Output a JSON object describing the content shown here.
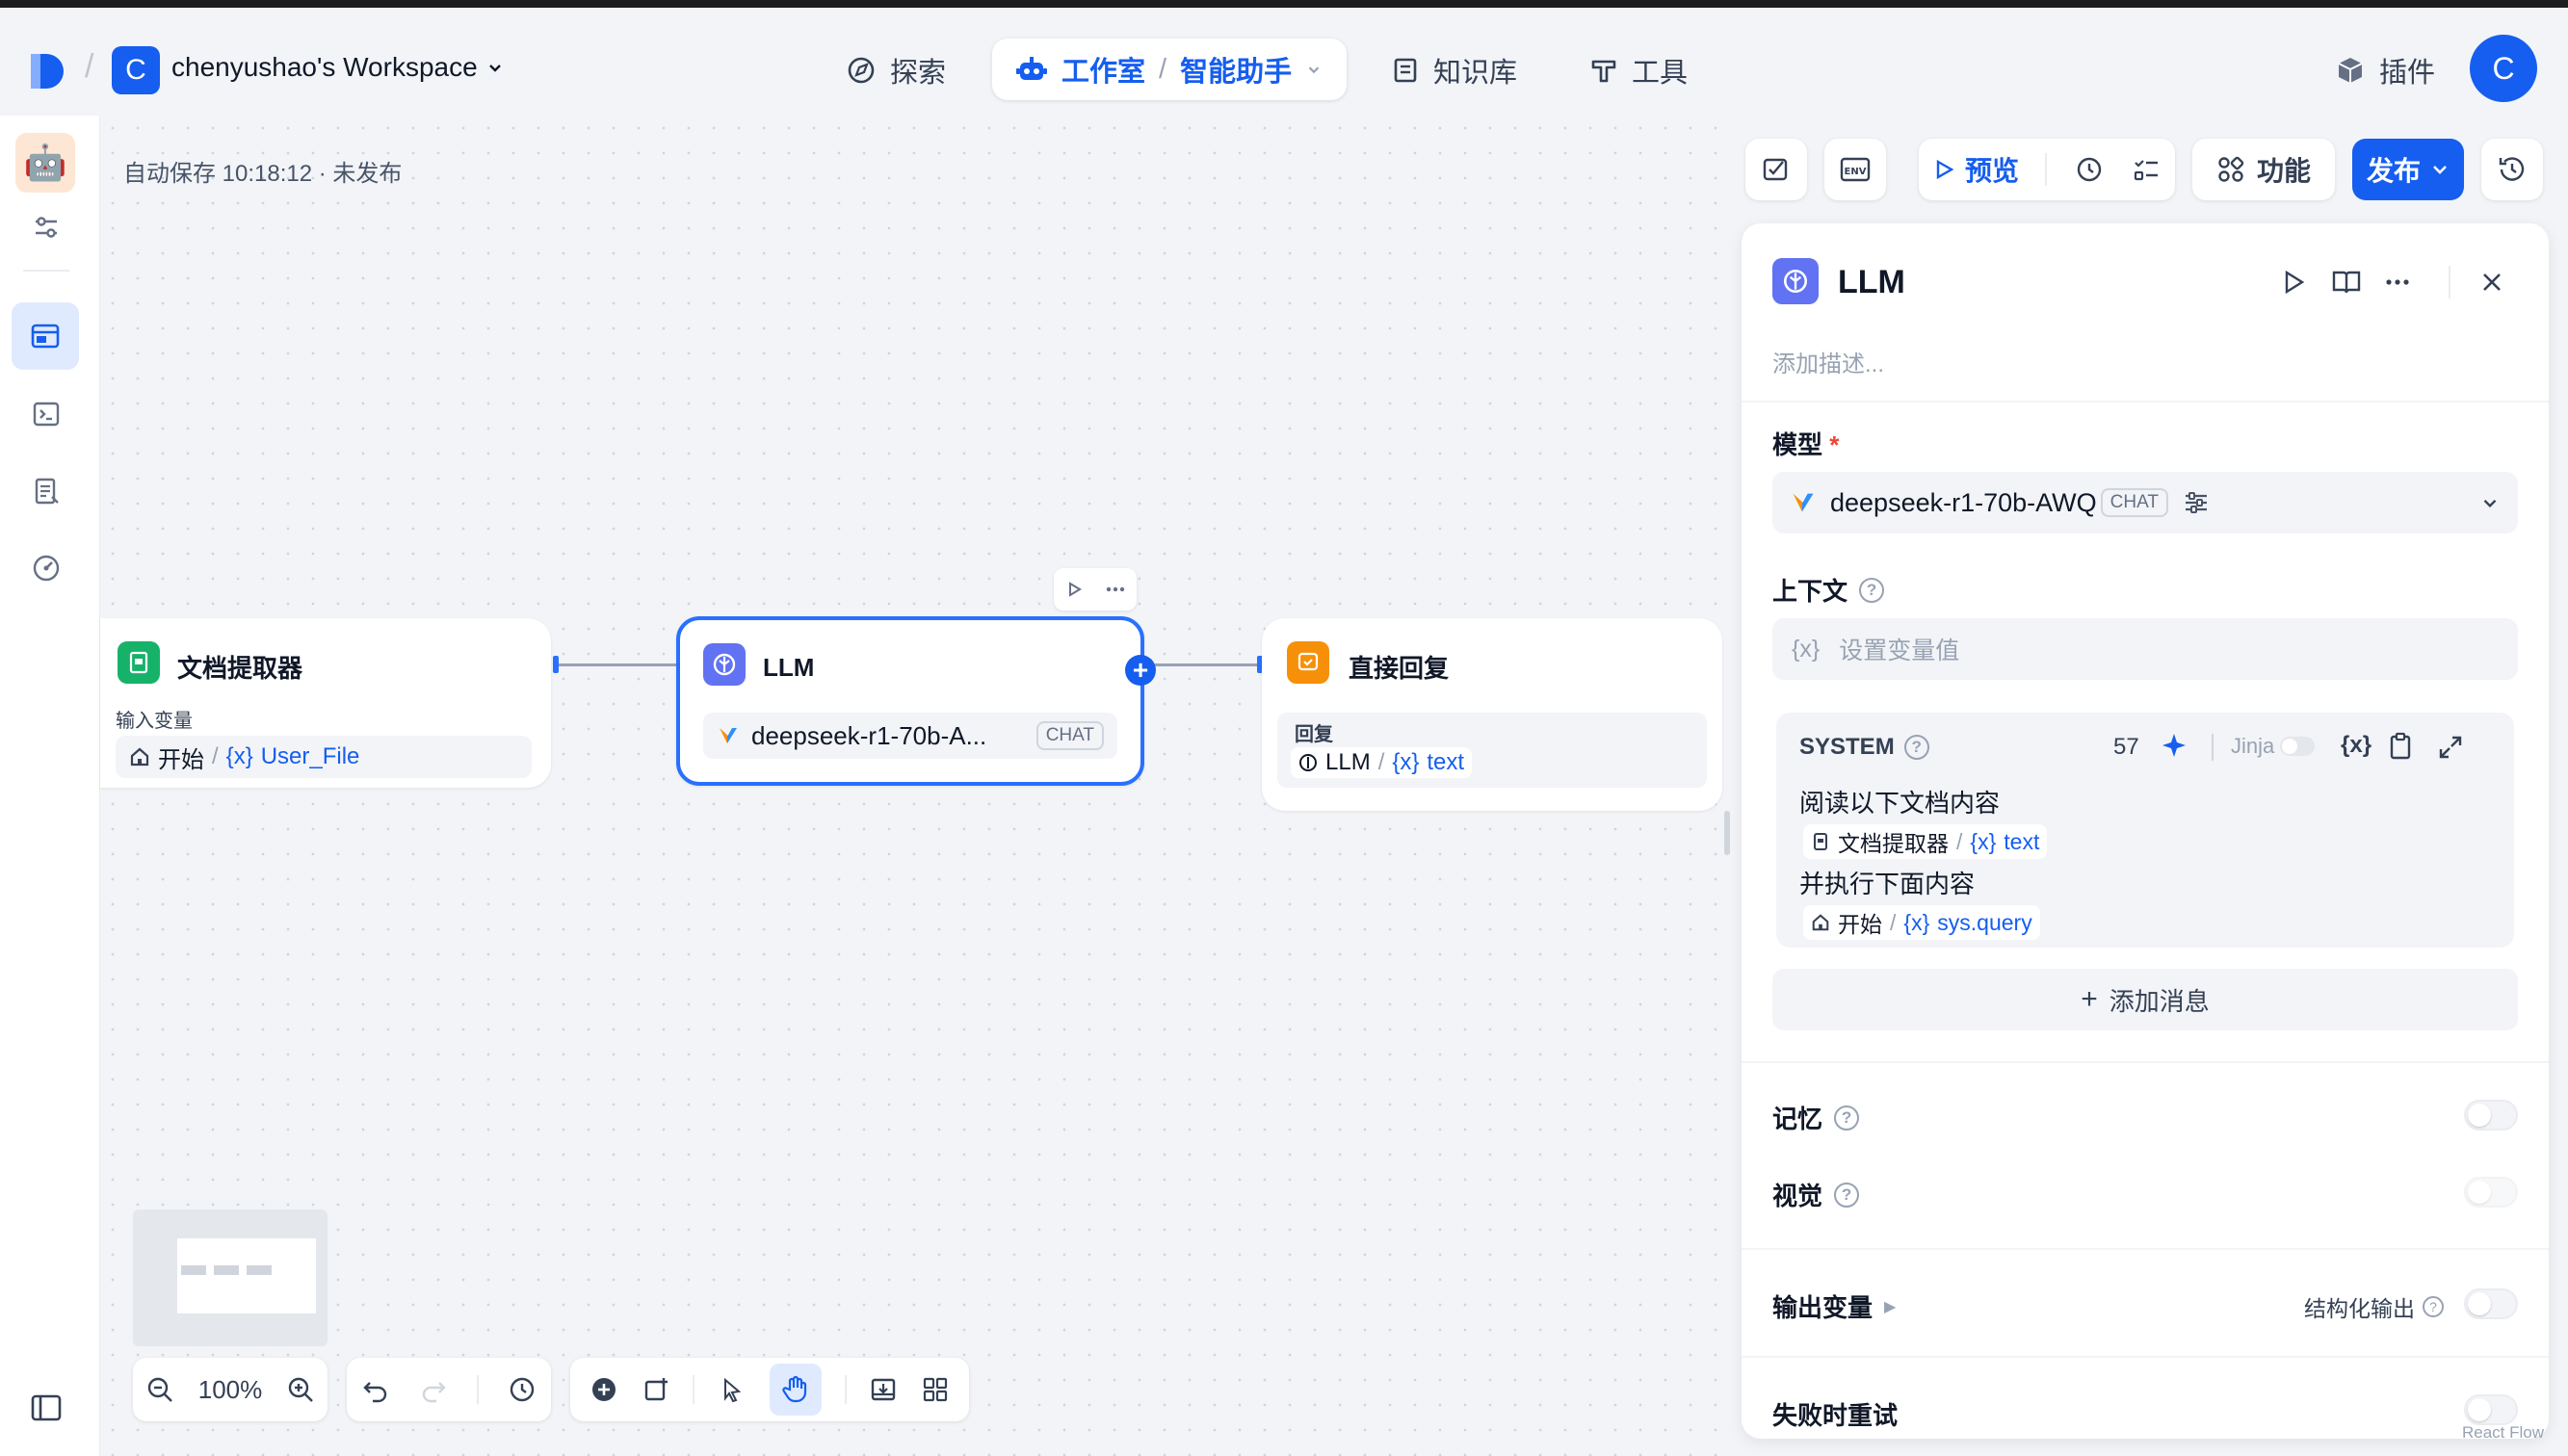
{
  "header": {
    "workspace_initial": "C",
    "workspace_name": "chenyushao's Workspace",
    "nav_explore": "探索",
    "nav_studio": "工作室",
    "nav_app": "智能助手",
    "nav_knowledge": "知识库",
    "nav_tools": "工具",
    "plugins": "插件",
    "avatar_initial": "C"
  },
  "canvas": {
    "autosave": "自动保存 10:18:12 · 未发布",
    "zoom": "100%",
    "nodes": {
      "extractor": {
        "title": "文档提取器",
        "input_label": "输入变量",
        "source": "开始",
        "var": "User_File"
      },
      "llm": {
        "title": "LLM",
        "model": "deepseek-r1-70b-A...",
        "badge": "CHAT"
      },
      "reply": {
        "title": "直接回复",
        "label": "回复",
        "source": "LLM",
        "var": "text"
      }
    },
    "watermark": "React Flow"
  },
  "actions": {
    "preview": "预览",
    "features": "功能",
    "publish": "发布"
  },
  "panel": {
    "title": "LLM",
    "description_placeholder": "添加描述...",
    "model_label": "模型",
    "required_mark": "*",
    "model_name": "deepseek-r1-70b-AWQ",
    "model_badge": "CHAT",
    "context_label": "上下文",
    "context_placeholder": "设置变量值",
    "system_label": "SYSTEM",
    "system_count": "57",
    "jinja_label": "Jinja",
    "prompt_line1": "阅读以下文档内容",
    "prompt_var1_source": "文档提取器",
    "prompt_var1": "text",
    "prompt_line2": "并执行下面内容",
    "prompt_var2_source": "开始",
    "prompt_var2": "sys.query",
    "add_message": "添加消息",
    "memory_label": "记忆",
    "vision_label": "视觉",
    "output_label": "输出变量",
    "structured_label": "结构化输出",
    "retry_label": "失败时重试"
  },
  "colors": {
    "accent": "#155eef",
    "extractor_icon": "#17b26a",
    "llm_icon": "#6172f3",
    "reply_icon": "#f79009"
  }
}
